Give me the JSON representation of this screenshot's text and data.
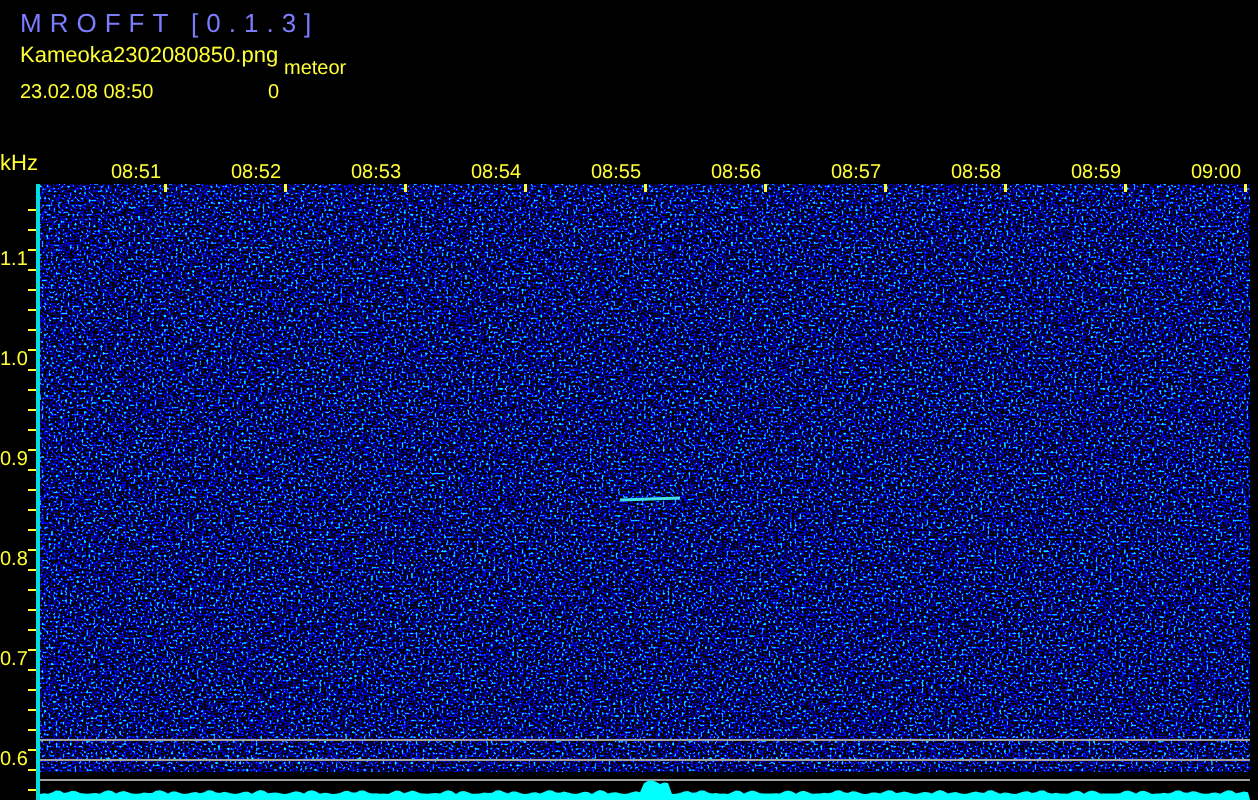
{
  "window": {
    "title": "MROFFT [0.1.3]"
  },
  "file": {
    "name": "Kameoka2302080850.png",
    "datetime": "23.02.08 08:50"
  },
  "counter": {
    "label": "meteor",
    "value": "0"
  },
  "spectrogram": {
    "y_unit": "kHz",
    "time_labels": [
      "08:51",
      "08:52",
      "08:53",
      "08:54",
      "08:55",
      "08:56",
      "08:57",
      "08:58",
      "08:59",
      "09:00"
    ],
    "freq_labels": [
      "1.1",
      "1.0",
      "0.9",
      "0.8",
      "0.7",
      "0.6"
    ]
  }
}
